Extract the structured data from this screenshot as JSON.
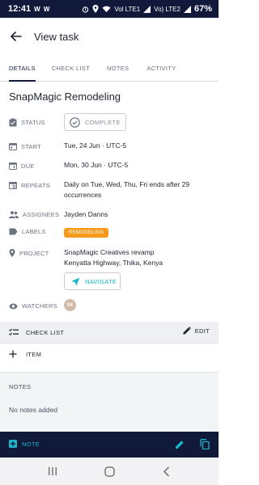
{
  "status_bar": {
    "time": "12:41",
    "notification_icons": "W W",
    "net_label_1": "Vol LTE1",
    "net_label_2": "Vo) LTE2",
    "battery": "67%"
  },
  "header": {
    "title": "View task"
  },
  "tabs": [
    {
      "label": "DETAILS",
      "active": true
    },
    {
      "label": "CHECK LIST",
      "active": false
    },
    {
      "label": "NOTES",
      "active": false
    },
    {
      "label": "ACTIVITY",
      "active": false
    }
  ],
  "task": {
    "title": "SnapMagic Remodeling",
    "status_label": "STATUS",
    "status_button": "COMPLETE",
    "start_label": "START",
    "start_value": "Tue, 24 Jun · UTC-5",
    "due_label": "DUE",
    "due_value": "Mon, 30 Jun · UTC-5",
    "repeats_label": "REPEATS",
    "repeats_value": "Daily on Tue, Wed, Thu, Fri ends after 29 occurrences",
    "assignees_label": "ASSIGNEES",
    "assignees_value": "Jayden Danns",
    "labels_label": "LABELS",
    "label_chip": "REMODELING",
    "project_label": "PROJECT",
    "project_name": "SnapMagic Creatives revamp",
    "project_address": "Kenyatta Highway, Thika, Kenya",
    "navigate_button": "NAVIGATE",
    "watchers_label": "WATCHERS",
    "watcher_initials": "SK"
  },
  "checklist": {
    "title": "CHECK LIST",
    "edit_label": "EDIT",
    "add_item_label": "ITEM"
  },
  "notes": {
    "title": "NOTES",
    "empty_text": "No notes added"
  },
  "bottom_bar": {
    "note_button": "NOTE"
  },
  "colors": {
    "navy": "#10193a",
    "accent_teal": "#19b7c9",
    "label_orange": "#f59a1b"
  }
}
